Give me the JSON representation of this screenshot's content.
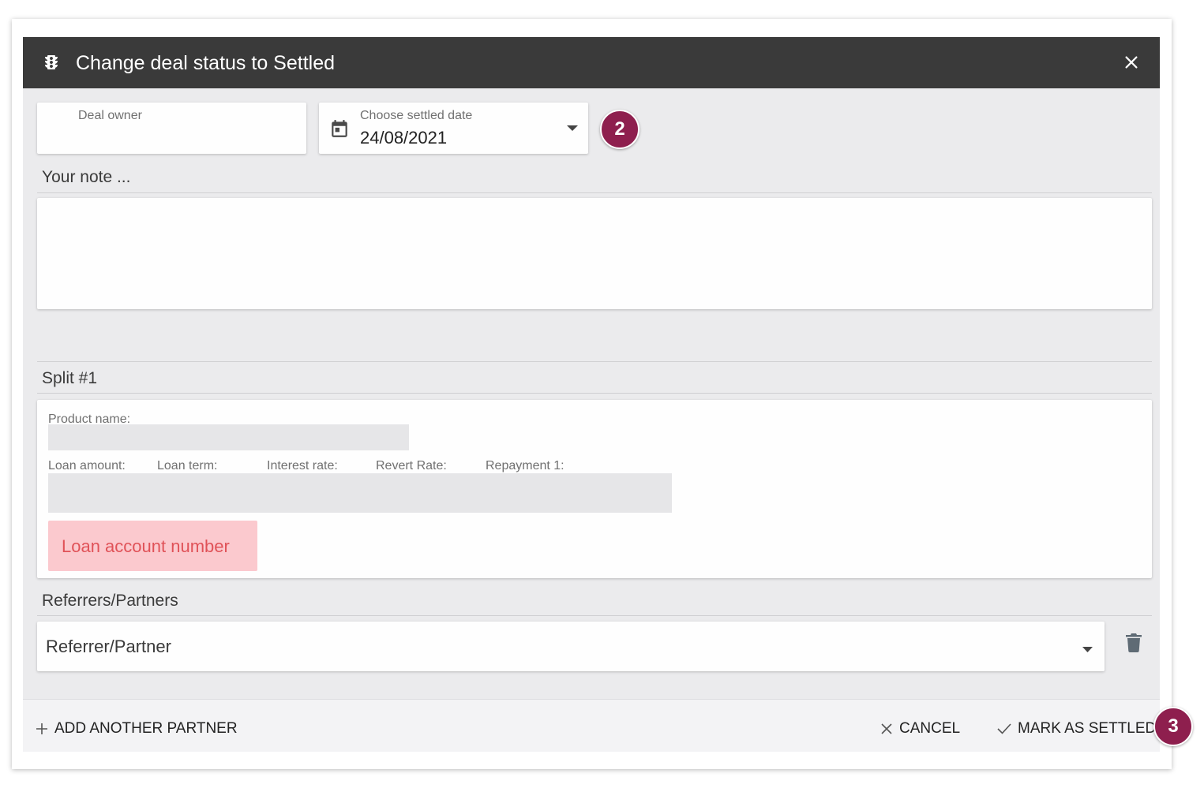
{
  "dialog": {
    "title": "Change deal status to Settled"
  },
  "fields": {
    "deal_owner_label": "Deal owner",
    "settled_date_label": "Choose settled date",
    "settled_date_value": "24/08/2021"
  },
  "note": {
    "title": "Your note ..."
  },
  "split": {
    "title": "Split #1",
    "product_name_label": "Product name:",
    "columns": [
      "Loan amount:",
      "Loan term:",
      "Interest rate:",
      "Revert Rate:",
      "Repayment 1:"
    ],
    "loan_account_label": "Loan account number"
  },
  "partners": {
    "title": "Referrers/Partners",
    "select_placeholder": "Referrer/Partner"
  },
  "footer": {
    "add_partner": "ADD ANOTHER PARTNER",
    "cancel": "CANCEL",
    "mark_settled": "MARK AS SETTLED"
  },
  "callouts": [
    "2",
    "3"
  ],
  "colors": {
    "header_bg": "#3a3a3a",
    "callout": "#8e1f4e",
    "loan_account_bg": "#fbc9ce",
    "loan_account_text": "#e05258"
  }
}
